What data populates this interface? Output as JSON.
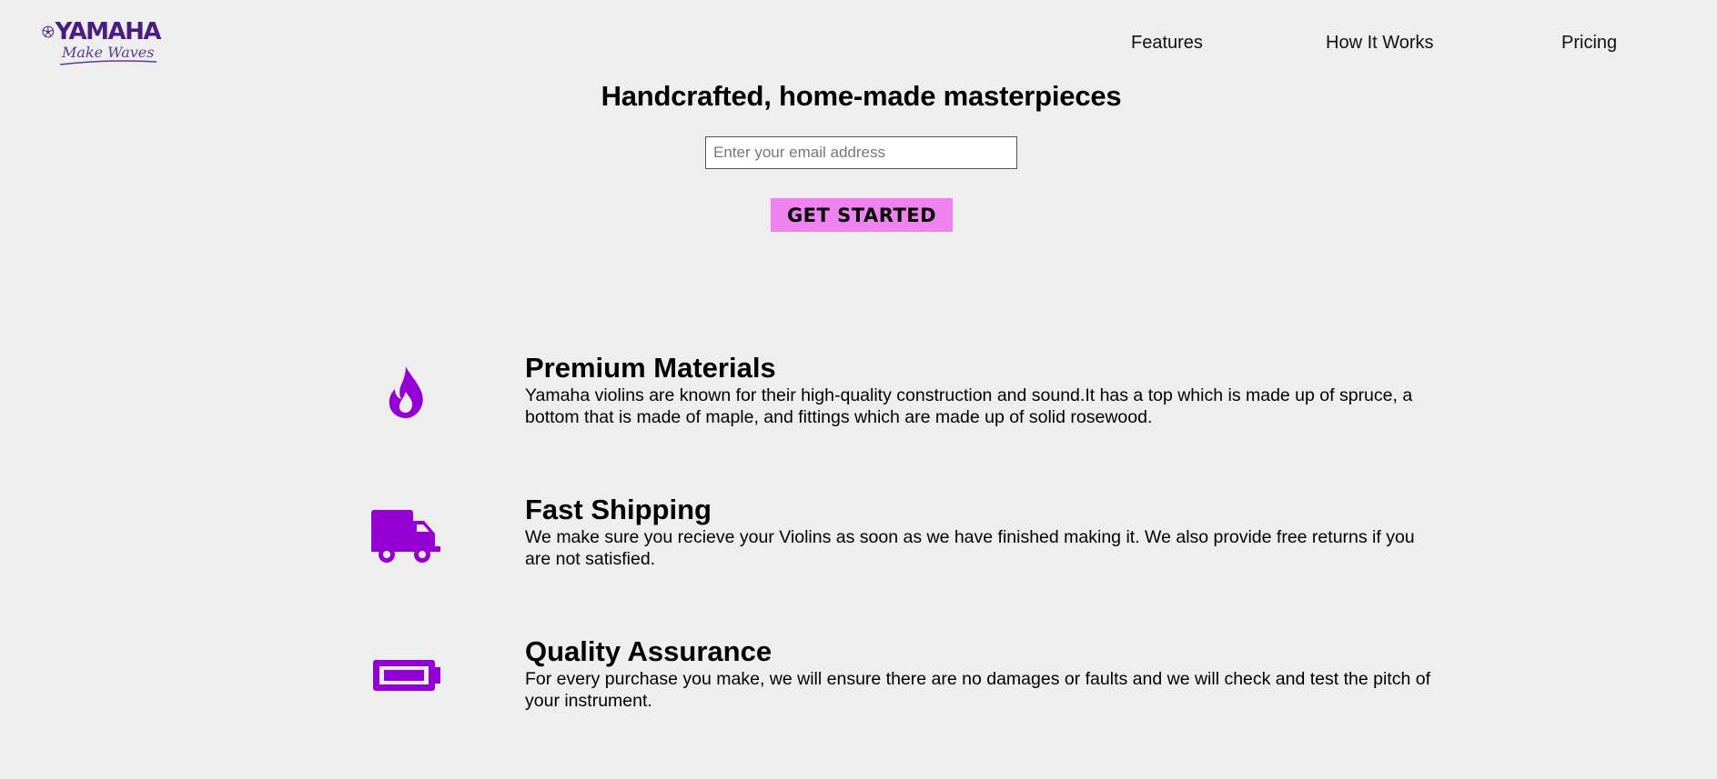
{
  "brand": {
    "name": "YAMAHA",
    "tagline": "Make Waves",
    "color": "#4a1e80"
  },
  "nav": {
    "items": [
      {
        "label": "Features"
      },
      {
        "label": "How It Works"
      },
      {
        "label": "Pricing"
      }
    ]
  },
  "hero": {
    "title": "Handcrafted, home-made masterpieces",
    "email_placeholder": "Enter your email address",
    "email_value": "",
    "cta_label": "GET STARTED",
    "cta_color": "#ee82ee"
  },
  "features": [
    {
      "icon": "fire-icon",
      "title": "Premium Materials",
      "description": "Yamaha violins are known for their high-quality construction and sound.It has a top which is made up of spruce, a bottom that is made of maple, and fittings which are made up of solid rosewood."
    },
    {
      "icon": "truck-icon",
      "title": "Fast Shipping",
      "description": "We make sure you recieve your Violins as soon as we have finished making it. We also provide free returns if you are not satisfied."
    },
    {
      "icon": "battery-icon",
      "title": "Quality Assurance",
      "description": "For every purchase you make, we will ensure there are no damages or faults and we will check and test the pitch of your instrument."
    }
  ],
  "colors": {
    "background": "#eeeeee",
    "icon": "#9400d3"
  }
}
